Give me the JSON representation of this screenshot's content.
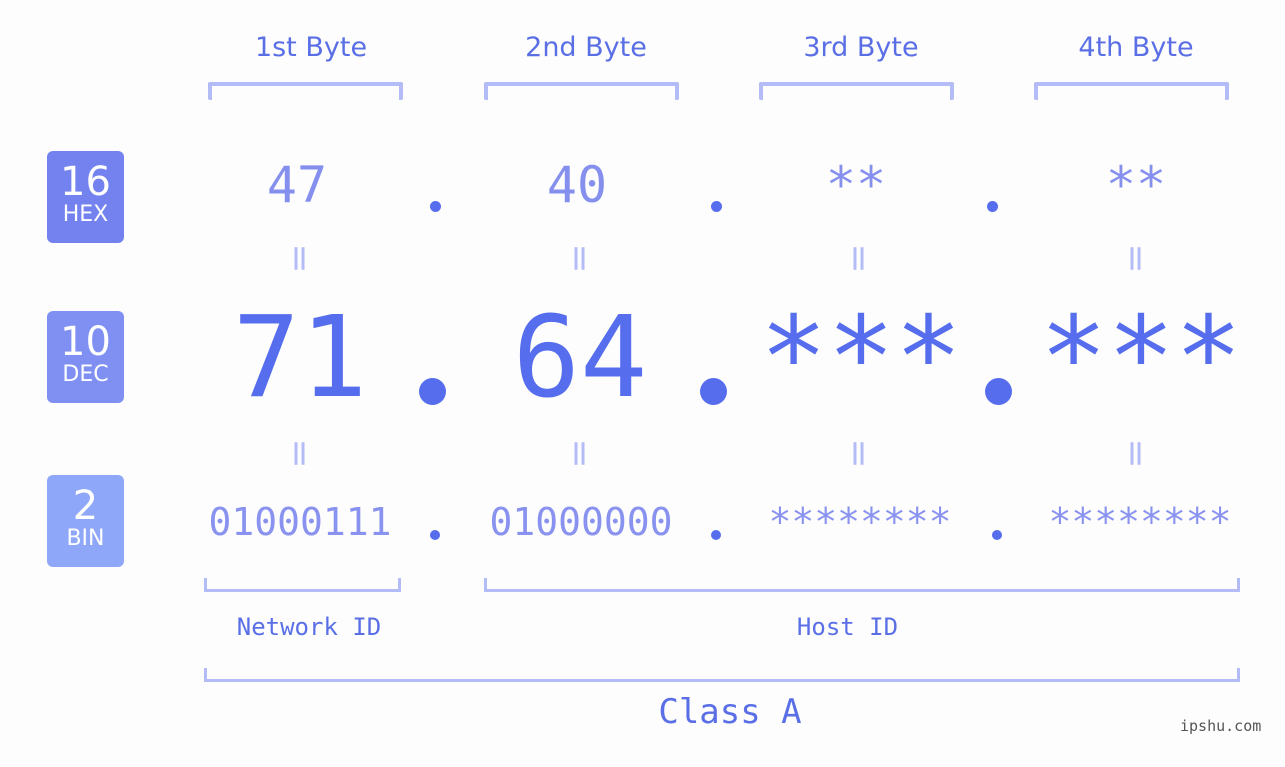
{
  "bytes": [
    {
      "header": "1st Byte",
      "hex": "47",
      "dec": "71",
      "bin": "01000111"
    },
    {
      "header": "2nd Byte",
      "hex": "40",
      "dec": "64",
      "bin": "01000000"
    },
    {
      "header": "3rd Byte",
      "hex": "**",
      "dec": "***",
      "bin": "********"
    },
    {
      "header": "4th Byte",
      "hex": "**",
      "dec": "***",
      "bin": "********"
    }
  ],
  "badges": {
    "hex": {
      "num": "16",
      "label": "HEX",
      "color": "#7382ee"
    },
    "dec": {
      "num": "10",
      "label": "DEC",
      "color": "#7f90f2"
    },
    "bin": {
      "num": "2",
      "label": "BIN",
      "color": "#8fa7f8"
    }
  },
  "equals_symbol": "=",
  "labels": {
    "network": "Network ID",
    "host": "Host ID",
    "class": "Class A"
  },
  "watermark": "ipshu.com"
}
